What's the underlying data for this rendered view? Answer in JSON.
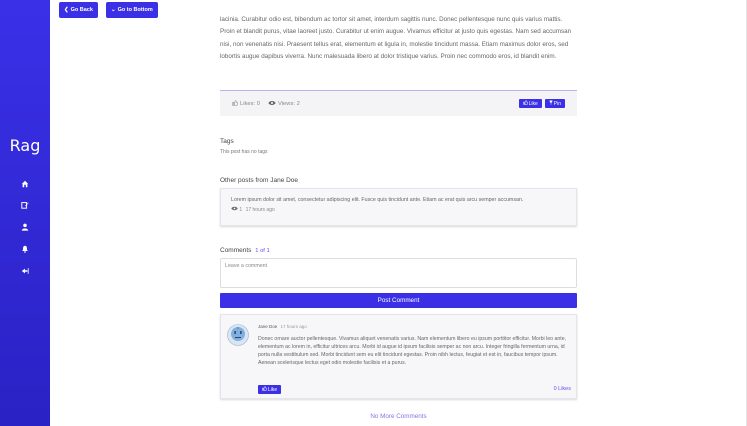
{
  "sidebar": {
    "brand": "Rag",
    "items": [
      {
        "icon": "home-icon",
        "glyph": "⌂"
      },
      {
        "icon": "edit-icon",
        "glyph": "✎"
      },
      {
        "icon": "user-icon",
        "glyph": "●"
      },
      {
        "icon": "bell-icon",
        "glyph": "▲"
      },
      {
        "icon": "logout-icon",
        "glyph": "⇥"
      }
    ]
  },
  "toolbar": {
    "back_label": "Go Back",
    "bottom_label": "Go to Bottom"
  },
  "post": {
    "body": "lacinia. Curabitur odio est, bibendum ac tortor sit amet, interdum sagittis nunc. Donec pellentesque nunc quis varius mattis. Proin et blandit purus, vitae laoreet justo. Curabitur ut enim augue. Vivamus efficitur at justo quis egestas. Nam sed accumsan nisi, non venenatis nisi. Praesent tellus erat, elementum et ligula in, molestie tincidunt massa. Etiam maximus dolor eros, sed lobortis augue dapibus viverra. Nunc malesuada libero at dolor tristique varius. Proin nec commodo eros, id blandit enim.",
    "likes_text": "Likes: 0",
    "views_text": "Views: 2",
    "like_label": "Like",
    "pin_label": "Pin"
  },
  "tags": {
    "title": "Tags",
    "empty_text": "This post has no tags"
  },
  "other_posts": {
    "title": "Other posts from Jane Doe",
    "items": [
      {
        "excerpt": "Lorem ipsum dolor sit amet, consectetur adipiscing elit. Fusce quis tincidunt ante. Etiam ac erat quis arcu semper accumsan.",
        "views": "1",
        "time": "17 hours ago"
      }
    ]
  },
  "comments": {
    "title": "Comments",
    "page_info": "1 of 1",
    "input_placeholder": "Leave a comment",
    "submit_label": "Post Comment",
    "items": [
      {
        "author": "Jane Doe",
        "time": "17 hours ago",
        "body": "Donec ornare auctor pellentesque. Vivamus aliquet venenatis varius. Nam elementum libero eu ipsum porttitor efficitur. Morbi leo ante, elementum ac lorem in, efficitur ultrices arcu. Morbi id augue id ipsum facilisis semper ac non arcu. Integer fringilla fermentum urna, id porta nulla vestibulum sed. Morbi tincidunt sem eu elit tincidunt egestas. Proin nibh lectus, feugiat et est in, faucibus tempor ipsum. Aenean scelerisque lectus eget odio molestie facilisis et a purus.",
        "like_label": "Like",
        "likes_count": "0 Likes"
      }
    ],
    "end_text": "No More Comments"
  },
  "colors": {
    "accent": "#3b30e6",
    "sidebar": "#2f27d6"
  }
}
